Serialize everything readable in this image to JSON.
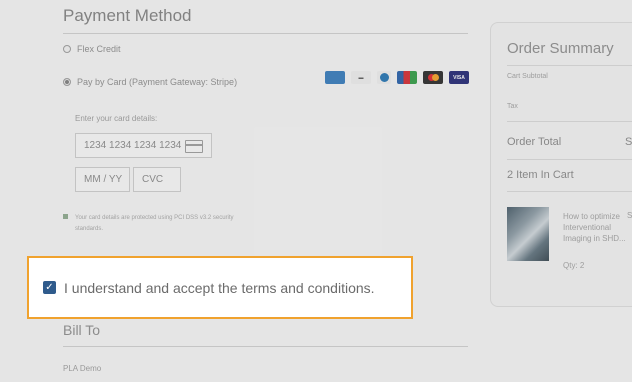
{
  "payment": {
    "title": "Payment Method",
    "options": [
      {
        "label": "Flex Credit",
        "selected": false
      },
      {
        "label": "Pay by Card (Payment Gateway: Stripe)",
        "selected": true
      }
    ],
    "card_brands": [
      "amex",
      "discover",
      "diners",
      "jcb",
      "mastercard",
      "visa"
    ],
    "card_hint": "Enter your card details:",
    "card_number_placeholder": "1234 1234 1234 1234",
    "expiry_placeholder": "MM / YY",
    "cvc_placeholder": "CVC",
    "secure_note": "Your card details are protected using PCI DSS v3.2 security standards."
  },
  "terms": {
    "checked": true,
    "label": "I understand and accept the terms and conditions."
  },
  "billing": {
    "title": "Bill To",
    "name": "PLA Demo"
  },
  "summary": {
    "title": "Order Summary",
    "cart_subtotal_label": "Cart Subtotal",
    "tax_label": "Tax",
    "order_total_label": "Order Total",
    "order_total_value": "S",
    "items_in_cart": "2 Item In Cart",
    "item": {
      "name": "How to optimize Interventional Imaging in SHD...",
      "price": "S",
      "qty": "Qty: 2"
    }
  },
  "colors": {
    "highlight_border": "#f0a22e",
    "checkbox": "#2f5b8c"
  }
}
